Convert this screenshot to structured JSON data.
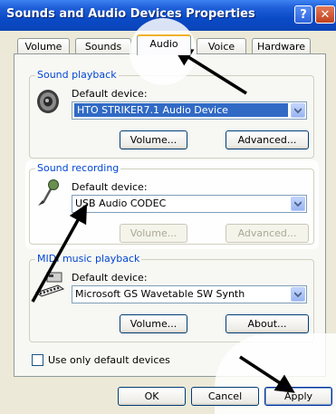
{
  "window": {
    "title": "Sounds and Audio Devices Properties",
    "help_glyph": "?",
    "close_glyph": "✕"
  },
  "tabs": [
    {
      "label": "Volume"
    },
    {
      "label": "Sounds"
    },
    {
      "label": "Audio"
    },
    {
      "label": "Voice"
    },
    {
      "label": "Hardware"
    }
  ],
  "active_tab": "Audio",
  "playback": {
    "legend": "Sound playback",
    "default_label": "Default device:",
    "device": "HTO STRIKER7.1 Audio Device",
    "volume_btn": "Volume...",
    "advanced_btn": "Advanced..."
  },
  "recording": {
    "legend": "Sound recording",
    "default_label": "Default device:",
    "device": "USB Audio CODEC",
    "volume_btn": "Volume...",
    "advanced_btn": "Advanced..."
  },
  "midi": {
    "legend": "MIDI music playback",
    "default_label": "Default device:",
    "device": "Microsoft GS Wavetable SW Synth",
    "volume_btn": "Volume...",
    "about_btn": "About..."
  },
  "use_default_only": {
    "label": "Use only default devices",
    "checked": false
  },
  "footer": {
    "ok": "OK",
    "cancel": "Cancel",
    "apply": "Apply"
  },
  "colors": {
    "title_blue": "#0a4ac6",
    "legend_blue": "#0046d5",
    "tab_orange": "#f0b229",
    "selection": "#316ac5"
  }
}
